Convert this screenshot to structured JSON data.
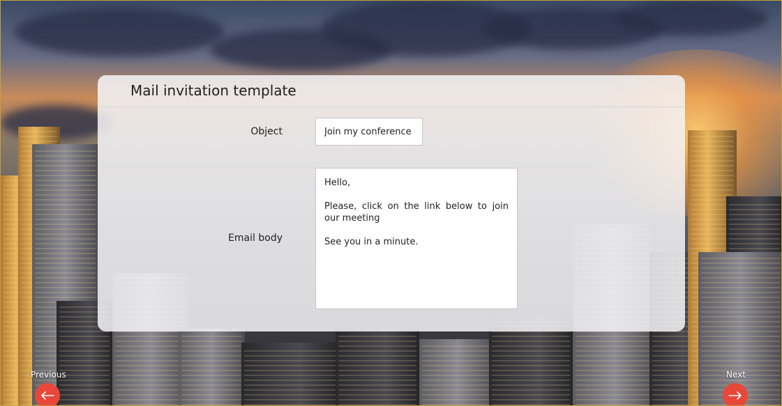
{
  "panel": {
    "title": "Mail invitation template"
  },
  "form": {
    "object_label": "Object",
    "object_value": "Join my conference",
    "body_label": "Email body",
    "body_lines": [
      "Hello,",
      "Please, click on the link below to join our meeting",
      "See you in a minute."
    ]
  },
  "navigation": {
    "previous_label": "Previous",
    "next_label": "Next",
    "previous_icon": "arrow-left-icon",
    "next_icon": "arrow-right-icon"
  },
  "colors": {
    "nav_button": "#e8473a",
    "frame_border": "#c8a133"
  }
}
